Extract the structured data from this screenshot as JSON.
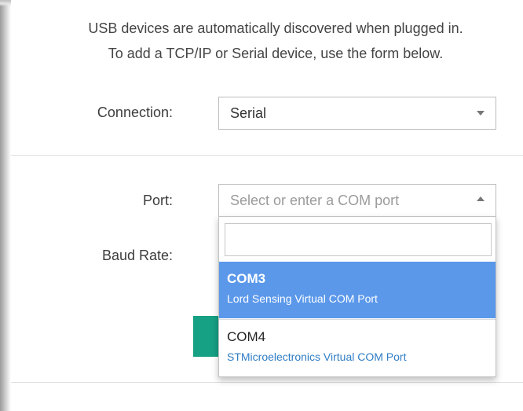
{
  "intro": {
    "line1": "USB devices are automatically discovered when plugged in.",
    "line2": "To add a TCP/IP or Serial device, use the form below."
  },
  "connection": {
    "label": "Connection:",
    "value": "Serial"
  },
  "port": {
    "label": "Port:",
    "placeholder": "Select or enter a COM port"
  },
  "baud": {
    "label": "Baud Rate:"
  },
  "dropdown": {
    "search_value": "",
    "options": [
      {
        "name": "COM3",
        "description": "Lord Sensing Virtual COM Port",
        "selected": true
      },
      {
        "name": "COM4",
        "description": "STMicroelectronics Virtual COM Port",
        "selected": false
      }
    ]
  },
  "colors": {
    "accent_green": "#16a084",
    "selection_blue": "#5b98ea",
    "link_blue": "#2f7dc4"
  }
}
